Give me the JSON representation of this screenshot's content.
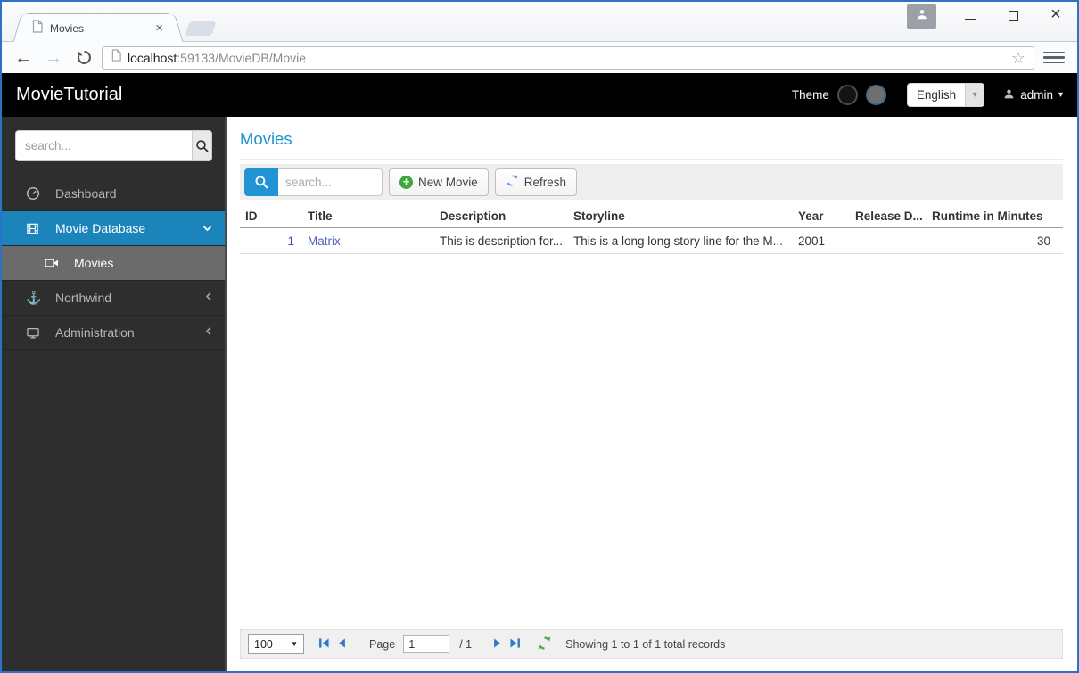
{
  "browser": {
    "tab_title": "Movies",
    "url_host": "localhost",
    "url_path": ":59133/MovieDB/Movie"
  },
  "icons": {
    "close_tab": "×",
    "window_close": "×",
    "back_arrow": "←",
    "forward_arrow": "→",
    "star": "☆",
    "caret_down": "▾",
    "select_caret": "▼",
    "anchor": "⚓",
    "chevron_left": "‹",
    "chevron_down": "⌄",
    "plus": "+"
  },
  "header": {
    "brand": "MovieTutorial",
    "theme_label": "Theme",
    "language": "English",
    "user": "admin"
  },
  "sidebar": {
    "search_placeholder": "search...",
    "items": [
      {
        "label": "Dashboard"
      },
      {
        "label": "Movie Database"
      },
      {
        "label": "Movies"
      },
      {
        "label": "Northwind"
      },
      {
        "label": "Administration"
      }
    ]
  },
  "main": {
    "title": "Movies",
    "toolbar": {
      "search_placeholder": "search...",
      "new_movie_label": "New Movie",
      "refresh_label": "Refresh"
    },
    "grid": {
      "columns": [
        "ID",
        "Title",
        "Description",
        "Storyline",
        "Year",
        "Release D...",
        "Runtime in Minutes"
      ],
      "rows": [
        {
          "id": "1",
          "title": "Matrix",
          "description": "This is description for...",
          "storyline": "This is a long long story line for the M...",
          "year": "2001",
          "release_date": "",
          "runtime": "30"
        }
      ]
    },
    "pager": {
      "page_size": "100",
      "page_label": "Page",
      "page_value": "1",
      "page_total": "/ 1",
      "summary": "Showing 1 to 1 of 1 total records"
    }
  },
  "colors": {
    "accent": "#2094d4",
    "menu_blue": "#1b84ba",
    "link": "#4d5dbe",
    "window_border": "#2a73c8"
  }
}
